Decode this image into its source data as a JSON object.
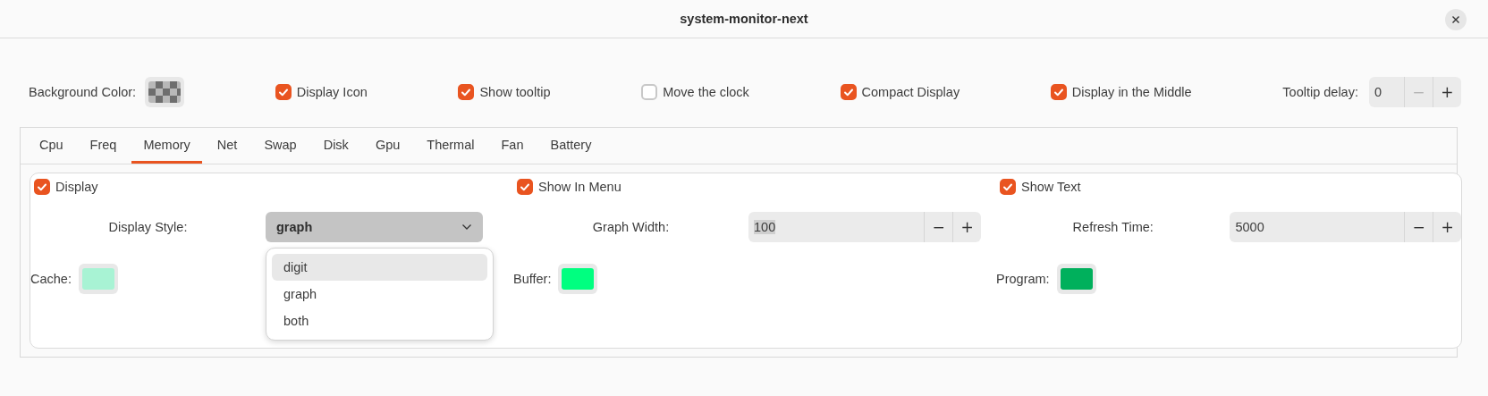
{
  "window": {
    "title": "system-monitor-next"
  },
  "general": {
    "background_color": {
      "label": "Background Color:",
      "transparent": true
    },
    "checks": [
      {
        "label": "Display Icon",
        "checked": true
      },
      {
        "label": "Show tooltip",
        "checked": true
      },
      {
        "label": "Move the clock",
        "checked": false
      },
      {
        "label": "Compact Display",
        "checked": true
      },
      {
        "label": "Display in the Middle",
        "checked": true
      }
    ],
    "tooltip_delay": {
      "label": "Tooltip delay:",
      "value": "0",
      "decrement_disabled": true,
      "minus": "−",
      "plus": "+"
    }
  },
  "tabs": [
    {
      "label": "Cpu",
      "selected": false
    },
    {
      "label": "Freq",
      "selected": false
    },
    {
      "label": "Memory",
      "selected": true
    },
    {
      "label": "Net",
      "selected": false
    },
    {
      "label": "Swap",
      "selected": false
    },
    {
      "label": "Disk",
      "selected": false
    },
    {
      "label": "Gpu",
      "selected": false
    },
    {
      "label": "Thermal",
      "selected": false
    },
    {
      "label": "Fan",
      "selected": false
    },
    {
      "label": "Battery",
      "selected": false
    }
  ],
  "panel": {
    "checks": [
      {
        "label": "Display",
        "checked": true
      },
      {
        "label": "Show In Menu",
        "checked": true
      },
      {
        "label": "Show Text",
        "checked": true
      }
    ],
    "settings": [
      {
        "kind": "dropdown",
        "label": "Display Style:",
        "value": "graph",
        "expanded": true,
        "options": [
          {
            "label": "digit",
            "hovered": true
          },
          {
            "label": "graph",
            "hovered": false
          },
          {
            "label": "both",
            "hovered": false
          }
        ]
      },
      {
        "kind": "spin",
        "label": "Graph Width:",
        "value": "100",
        "text_selected": true,
        "minus": "−",
        "plus": "+"
      },
      {
        "kind": "spin",
        "label": "Refresh Time:",
        "value": "5000",
        "minus": "−",
        "plus": "+"
      }
    ],
    "colors": [
      {
        "label": "Cache:",
        "color": "#a8f3d4"
      },
      {
        "label": "Buffer:",
        "color": "#00ff80"
      },
      {
        "label": "Program:",
        "color": "#00b05c"
      }
    ]
  }
}
